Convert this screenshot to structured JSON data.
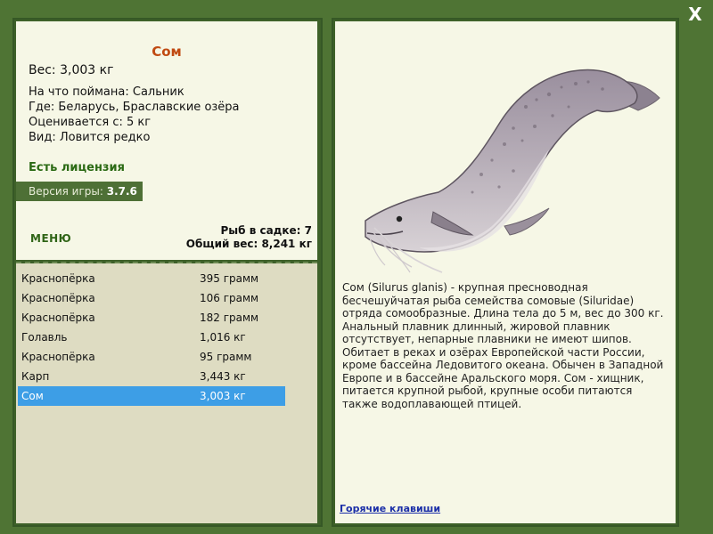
{
  "close_label": "X",
  "fish": {
    "name": "Сом",
    "weight_line": "Вес: 3,003 кг",
    "caught_with": "На что поймана: Сальник",
    "location": "Где: Беларусь, Браславские озёра",
    "valued_from": "Оценивается с: 5 кг",
    "rarity": "Вид: Ловится редко"
  },
  "license": "Есть лицензия",
  "version": {
    "label": "Версия игры:",
    "value": "3.7.6"
  },
  "menu_label": "МЕНЮ",
  "totals": {
    "fish_in_keepnet": "Рыб в садке: 7",
    "total_weight": "Общий вес: 8,241 кг"
  },
  "catch_list": [
    {
      "name": "Краснопёрка",
      "weight": "395 грамм"
    },
    {
      "name": "Краснопёрка",
      "weight": "106 грамм"
    },
    {
      "name": "Краснопёрка",
      "weight": "182 грамм"
    },
    {
      "name": "Голавль",
      "weight": "1,016 кг"
    },
    {
      "name": "Краснопёрка",
      "weight": "95 грамм"
    },
    {
      "name": "Карп",
      "weight": "3,443 кг"
    },
    {
      "name": "Сом",
      "weight": "3,003 кг",
      "selected": true
    }
  ],
  "description": "Сом (Silurus glanis) - крупная пресноводная бесчешуйчатая рыба семейства сомовые (Siluridae) отряда сомообразные. Длина тела до 5 м, вес до 300 кг. Анальный плавник длинный, жировой плавник отсутствует, непарные плавники не имеют шипов. Обитает в реках и озёрах Европейской части России, кроме бассейна Ледовитого океана. Обычен в Западной Европе и в бассейне Аральского моря. Сом - хищник, питается крупной рыбой, крупные особи питаются также водоплавающей птицей.",
  "hotkeys_label": "Горячие клавиши",
  "colors": {
    "background": "#4f7434",
    "panel": "#f6f7e6",
    "list_panel": "#dedcc2",
    "title": "#c04a12",
    "license": "#2b6a14",
    "selected_row": "#3d9ee6",
    "link": "#1b2fa8"
  }
}
